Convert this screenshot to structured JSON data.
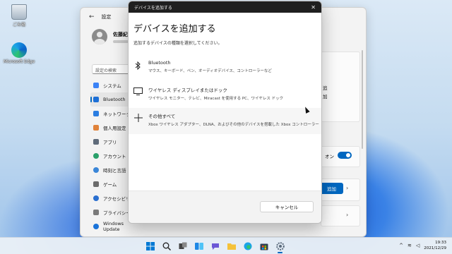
{
  "desktop": {
    "icons": [
      {
        "label": "ごみ箱"
      },
      {
        "label": "Microsoft Edge"
      }
    ]
  },
  "settings": {
    "title": "設定",
    "profile_name": "佐藤紀",
    "search_placeholder": "設定の検索",
    "nav": [
      {
        "label": "システム",
        "color": "#3b82f6"
      },
      {
        "label": "Bluetooth",
        "color": "#1d6fd6",
        "active": true
      },
      {
        "label": "ネットワーク",
        "color": "#2a7de1"
      },
      {
        "label": "個人用設定",
        "color": "#e0823a"
      },
      {
        "label": "アプリ",
        "color": "#5f6b7a"
      },
      {
        "label": "アカウント",
        "color": "#2aa06a"
      },
      {
        "label": "時刻と言語",
        "color": "#3a86d8"
      },
      {
        "label": "ゲーム",
        "color": "#6b6b6b"
      },
      {
        "label": "アクセシビリ",
        "color": "#2a6fd0"
      },
      {
        "label": "プライバシー",
        "color": "#7a7a7a"
      },
      {
        "label": "Windows Update",
        "color": "#1a73d9"
      }
    ],
    "right_fragment_1": "追",
    "right_fragment_2": "加",
    "toggle_label": "オン",
    "add_button_label": "追加"
  },
  "dialog": {
    "titlebar": "デバイスを追加する",
    "heading": "デバイスを追加する",
    "description": "追加するデバイスの種類を選択してください。",
    "options": [
      {
        "icon": "bluetooth-icon",
        "title": "Bluetooth",
        "subtitle": "マウス、キーボード、ペン、オーディオデバイス、コントローラーなど"
      },
      {
        "icon": "monitor-icon",
        "title": "ワイヤレス ディスプレイまたはドック",
        "subtitle": "ワイヤレス モニター、テレビ、Miracast を使用する PC、ワイヤレス ドック"
      },
      {
        "icon": "plus-icon",
        "title": "その他すべて",
        "subtitle": "Xbox ワイヤレス アダプター、DLNA、およびその他のデバイスを搭載した Xbox コントローラー"
      }
    ],
    "cancel_label": "キャンセル"
  },
  "taskbar": {
    "apps": [
      "start-icon",
      "search-icon",
      "task-view-icon",
      "widgets-icon",
      "chat-icon",
      "file-explorer-icon",
      "edge-icon",
      "store-icon",
      "settings-icon"
    ],
    "time": "19:33",
    "date": "2021/12/29"
  }
}
